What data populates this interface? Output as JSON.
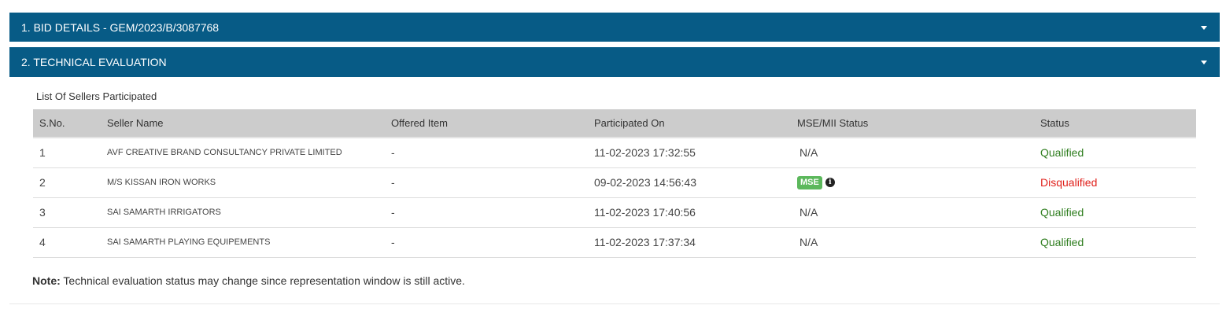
{
  "panels": [
    {
      "title": "1. BID DETAILS - GEM/2023/B/3087768"
    },
    {
      "title": "2. TECHNICAL EVALUATION"
    }
  ],
  "list_title": "List Of Sellers Participated",
  "table": {
    "headers": {
      "sno": "S.No.",
      "seller": "Seller Name",
      "item": "Offered Item",
      "participated": "Participated On",
      "mse": "MSE/MII Status",
      "status": "Status"
    },
    "rows": [
      {
        "sno": "1",
        "seller": "AVF CREATIVE BRAND CONSULTANCY PRIVATE LIMITED",
        "item": "-",
        "participated": "11-02-2023 17:32:55",
        "mse": "N/A",
        "status": "Qualified"
      },
      {
        "sno": "2",
        "seller": "M/S KISSAN IRON WORKS",
        "item": "-",
        "participated": "09-02-2023 14:56:43",
        "mse_badge": "MSE",
        "status": "Disqualified"
      },
      {
        "sno": "3",
        "seller": "SAI SAMARTH IRRIGATORS",
        "item": "-",
        "participated": "11-02-2023 17:40:56",
        "mse": "N/A",
        "status": "Qualified"
      },
      {
        "sno": "4",
        "seller": "SAI SAMARTH PLAYING EQUIPEMENTS",
        "item": "-",
        "participated": "11-02-2023 17:37:34",
        "mse": "N/A",
        "status": "Qualified"
      }
    ]
  },
  "note": {
    "label": "Note:",
    "text": " Technical evaluation status may change since representation window is still active."
  },
  "icons": {
    "panel_toggle": "caret-down-icon",
    "mse_info": "info-circle-icon"
  },
  "colors": {
    "header_bg": "#075b86",
    "qualified": "#2e7d1e",
    "disqualified": "#e0201b",
    "mse_badge": "#5cb85c"
  }
}
